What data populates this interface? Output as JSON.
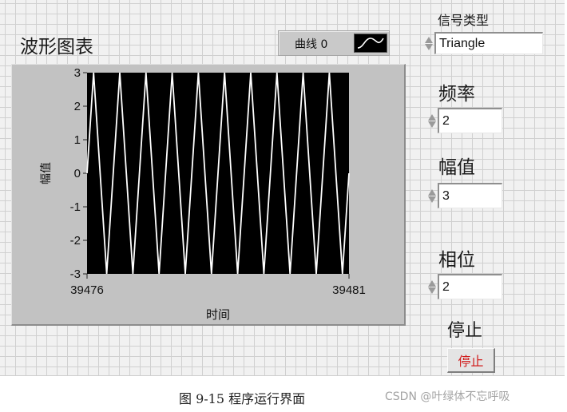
{
  "front_panel": {
    "graph": {
      "title": "波形图表",
      "legend": {
        "plot_name": "曲线 0",
        "plot_icon": "line-plot-icon"
      }
    },
    "controls": {
      "signal_type": {
        "label": "信号类型",
        "value": "Triangle"
      },
      "frequency": {
        "label": "频率",
        "value": "2"
      },
      "amplitude": {
        "label": "幅值",
        "value": "3"
      },
      "phase": {
        "label": "相位",
        "value": "2"
      },
      "stop": {
        "label": "停止",
        "button_text": "停止"
      }
    }
  },
  "caption": "图 9-15  程序运行界面",
  "watermark": "CSDN @叶绿体不忘呼吸",
  "colors": {
    "plot_background": "#000000",
    "trace": "#ffffff",
    "stop_text": "#d11a1a",
    "panel_background": "#f1f1f1"
  },
  "chart_data": {
    "type": "line",
    "title": "波形图表",
    "xlabel": "时间",
    "ylabel": "幅值",
    "xlim": [
      39476,
      39481
    ],
    "ylim": [
      -3,
      3
    ],
    "x_ticks": [
      "39476",
      "39481"
    ],
    "y_ticks": [
      "3",
      "2",
      "1",
      "0",
      "-1",
      "-2",
      "-3"
    ],
    "grid": false,
    "legend": "top-right",
    "series": [
      {
        "name": "曲线 0",
        "x": [
          39476,
          39476.125,
          39476.375,
          39476.625,
          39476.875,
          39477.125,
          39477.375,
          39477.625,
          39477.875,
          39478.125,
          39478.375,
          39478.625,
          39478.875,
          39479.125,
          39479.375,
          39479.625,
          39479.875,
          39480.125,
          39480.375,
          39480.625,
          39480.875,
          39481
        ],
        "y": [
          0,
          3,
          -3,
          3,
          -3,
          3,
          -3,
          3,
          -3,
          3,
          -3,
          3,
          -3,
          3,
          -3,
          3,
          -3,
          3,
          -3,
          3,
          -3,
          0
        ]
      }
    ]
  }
}
